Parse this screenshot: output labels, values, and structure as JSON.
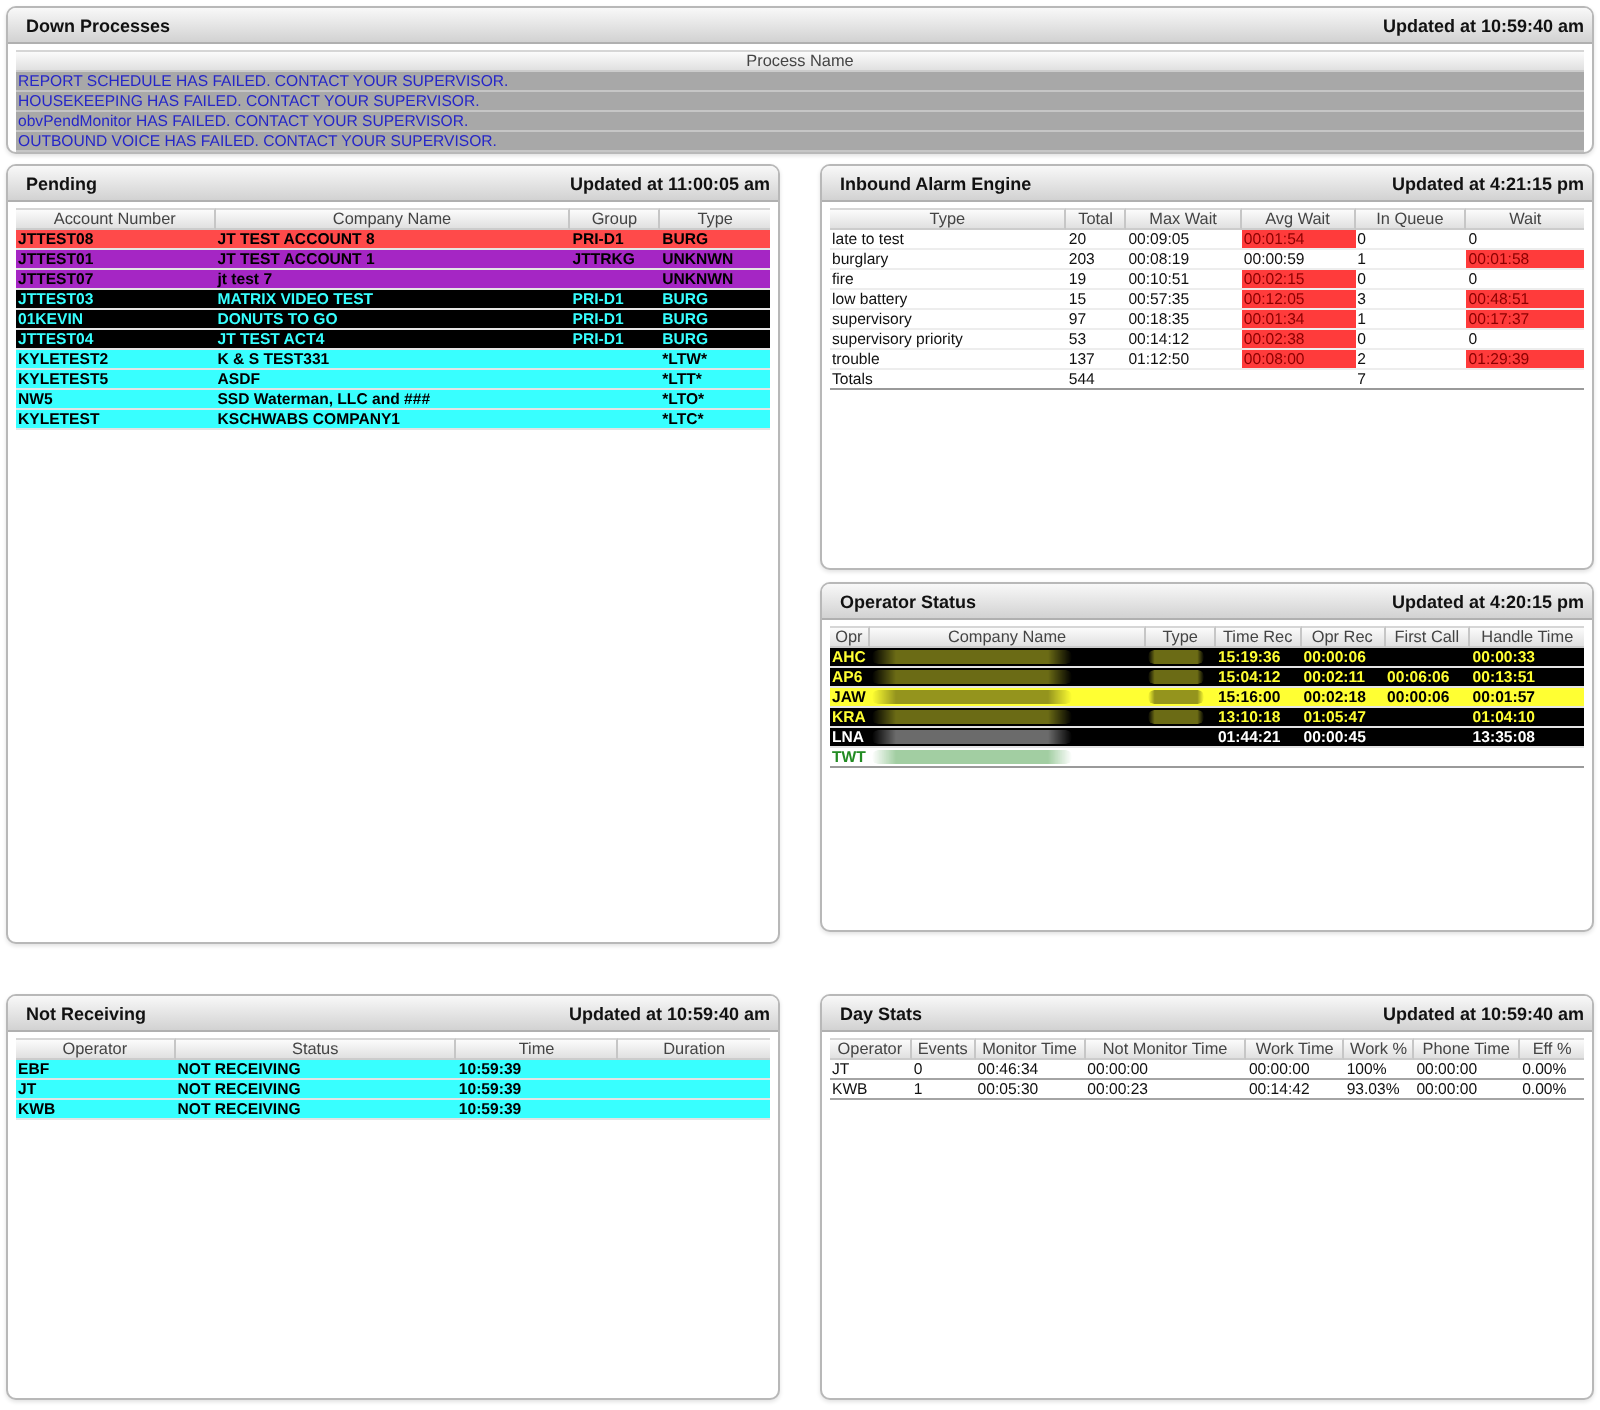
{
  "down_processes": {
    "title": "Down Processes",
    "updated": "Updated at 10:59:40 am",
    "columns": [
      "Process Name"
    ],
    "rows": [
      "REPORT SCHEDULE HAS FAILED. CONTACT YOUR SUPERVISOR.",
      "HOUSEKEEPING HAS FAILED. CONTACT YOUR SUPERVISOR.",
      "obvPendMonitor HAS FAILED. CONTACT YOUR SUPERVISOR.",
      "OUTBOUND VOICE HAS FAILED. CONTACT YOUR SUPERVISOR."
    ]
  },
  "pending": {
    "title": "Pending",
    "updated": "Updated at 11:00:05 am",
    "columns": [
      "Account Number",
      "Company Name",
      "Group",
      "Type"
    ],
    "rows": [
      {
        "account_number": "JTTEST08",
        "company_name": "JT TEST ACCOUNT 8",
        "group": "PRI-D1",
        "type": "BURG",
        "color": "#ff4a4a"
      },
      {
        "account_number": "JTTEST01",
        "company_name": "JT TEST ACCOUNT 1",
        "group": "JTTRKG",
        "type": "UNKNWN",
        "color": "#a526c4"
      },
      {
        "account_number": "JTTEST07",
        "company_name": "jt test 7",
        "type": "UNKNWN",
        "color": "#a526c4"
      },
      {
        "account_number": "JTTEST03",
        "company_name": "MATRIX VIDEO TEST",
        "group": "PRI-D1",
        "type": "BURG",
        "color": "#000000"
      },
      {
        "account_number": "01KEVIN",
        "company_name": "DONUTS TO GO",
        "group": "PRI-D1",
        "type": "BURG",
        "color": "#000000"
      },
      {
        "account_number": "JTTEST04",
        "company_name": "JT TEST ACT4",
        "group": "PRI-D1",
        "type": "BURG",
        "color": "#000000"
      },
      {
        "account_number": "KYLETEST2",
        "company_name": "K & S TEST331",
        "type": "*LTW*",
        "color": "#38ffff"
      },
      {
        "account_number": "KYLETEST5",
        "company_name": "ASDF",
        "type": "*LTT*",
        "color": "#38ffff"
      },
      {
        "account_number": "NW5",
        "company_name": "SSD Waterman, LLC and ###",
        "type": "*LTO*",
        "color": "#38ffff"
      },
      {
        "account_number": "KYLETEST",
        "company_name": "KSCHWABS COMPANY1",
        "type": "*LTC*",
        "color": "#38ffff"
      }
    ]
  },
  "inbound_alarm_engine": {
    "title": "Inbound Alarm Engine",
    "updated": "Updated at 4:21:15 pm",
    "columns": [
      "Type",
      "Total",
      "Max Wait",
      "Avg Wait",
      "In Queue",
      "Wait"
    ],
    "rows": [
      {
        "type": "late to test",
        "total": "20",
        "max_wait": "00:09:05",
        "avg_wait": {
          "value": "00:01:54",
          "alert": true
        },
        "in_queue": "0",
        "wait": {
          "value": "0",
          "alert": false
        }
      },
      {
        "type": "burglary",
        "total": "203",
        "max_wait": "00:08:19",
        "avg_wait": {
          "value": "00:00:59",
          "alert": false
        },
        "in_queue": "1",
        "wait": {
          "value": "00:01:58",
          "alert": true
        }
      },
      {
        "type": "fire",
        "total": "19",
        "max_wait": "00:10:51",
        "avg_wait": {
          "value": "00:02:15",
          "alert": true
        },
        "in_queue": "0",
        "wait": {
          "value": "0",
          "alert": false
        }
      },
      {
        "type": "low battery",
        "total": "15",
        "max_wait": "00:57:35",
        "avg_wait": {
          "value": "00:12:05",
          "alert": true
        },
        "in_queue": "3",
        "wait": {
          "value": "00:48:51",
          "alert": true
        }
      },
      {
        "type": "supervisory",
        "total": "97",
        "max_wait": "00:18:35",
        "avg_wait": {
          "value": "00:01:34",
          "alert": true
        },
        "in_queue": "1",
        "wait": {
          "value": "00:17:37",
          "alert": true
        }
      },
      {
        "type": "supervisory priority",
        "total": "53",
        "max_wait": "00:14:12",
        "avg_wait": {
          "value": "00:02:38",
          "alert": true
        },
        "in_queue": "0",
        "wait": {
          "value": "0",
          "alert": false
        }
      },
      {
        "type": "trouble",
        "total": "137",
        "max_wait": "01:12:50",
        "avg_wait": {
          "value": "00:08:00",
          "alert": true
        },
        "in_queue": "2",
        "wait": {
          "value": "01:29:39",
          "alert": true
        }
      }
    ],
    "totals": {
      "label": "Totals",
      "total": "544",
      "in_queue": "7"
    }
  },
  "operator_status": {
    "title": "Operator Status",
    "updated": "Updated at 4:20:15 pm",
    "columns": [
      "Opr",
      "Company Name",
      "Type",
      "Time Rec",
      "Opr Rec",
      "First Call",
      "Handle Time"
    ],
    "rows": [
      {
        "kind": "accent",
        "opr": "AHC",
        "company_redacted": true,
        "type_redacted": true,
        "time_rec": "15:19:36",
        "opr_rec": "00:00:06",
        "handle_time": "00:00:33",
        "color": "#000000"
      },
      {
        "kind": "accent",
        "opr": "AP6",
        "company_redacted": true,
        "type_redacted": true,
        "time_rec": "15:04:12",
        "opr_rec": "00:02:11",
        "first_call": "00:06:06",
        "handle_time": "00:13:51",
        "color": "#000000"
      },
      {
        "kind": "accent",
        "opr": "JAW",
        "company_redacted": true,
        "type_redacted": true,
        "time_rec": "15:16:00",
        "opr_rec": "00:02:18",
        "first_call": "00:00:06",
        "handle_time": "00:01:57",
        "color": "#ffff33"
      },
      {
        "kind": "accent",
        "opr": "KRA",
        "company_redacted": true,
        "type_redacted": true,
        "time_rec": "13:10:18",
        "opr_rec": "01:05:47",
        "handle_time": "01:04:10",
        "color": "#000000"
      },
      {
        "kind": "plain",
        "opr": "LNA",
        "company_redacted": true,
        "type_redacted": false,
        "time_rec": "01:44:21",
        "opr_rec": "00:00:45",
        "handle_time": "13:35:08",
        "color": "#000000"
      },
      {
        "kind": "muted",
        "opr": "TWT",
        "company_redacted": true,
        "type_redacted": false,
        "color": "#ffffff"
      }
    ]
  },
  "not_receiving": {
    "title": "Not Receiving",
    "updated": "Updated at 10:59:40 am",
    "columns": [
      "Operator",
      "Status",
      "Time",
      "Duration"
    ],
    "rows": [
      {
        "operator": "EBF",
        "status": "NOT RECEIVING",
        "time": "10:59:39"
      },
      {
        "operator": "JT",
        "status": "NOT RECEIVING",
        "time": "10:59:39"
      },
      {
        "operator": "KWB",
        "status": "NOT RECEIVING",
        "time": "10:59:39"
      }
    ]
  },
  "day_stats": {
    "title": "Day Stats",
    "updated": "Updated at 10:59:40 am",
    "columns": [
      "Operator",
      "Events",
      "Monitor Time",
      "Not Monitor Time",
      "Work Time",
      "Work %",
      "Phone Time",
      "Eff %"
    ],
    "rows": [
      {
        "operator": "JT",
        "events": "0",
        "monitor_time": "00:46:34",
        "not_monitor_time": "00:00:00",
        "work_time": "00:00:00",
        "work_pct": "100%",
        "phone_time": "00:00:00",
        "eff_pct": "0.00%"
      },
      {
        "operator": "KWB",
        "events": "1",
        "monitor_time": "00:05:30",
        "not_monitor_time": "00:00:23",
        "work_time": "00:14:42",
        "work_pct": "93.03%",
        "phone_time": "00:00:00",
        "eff_pct": "0.00%"
      }
    ]
  }
}
